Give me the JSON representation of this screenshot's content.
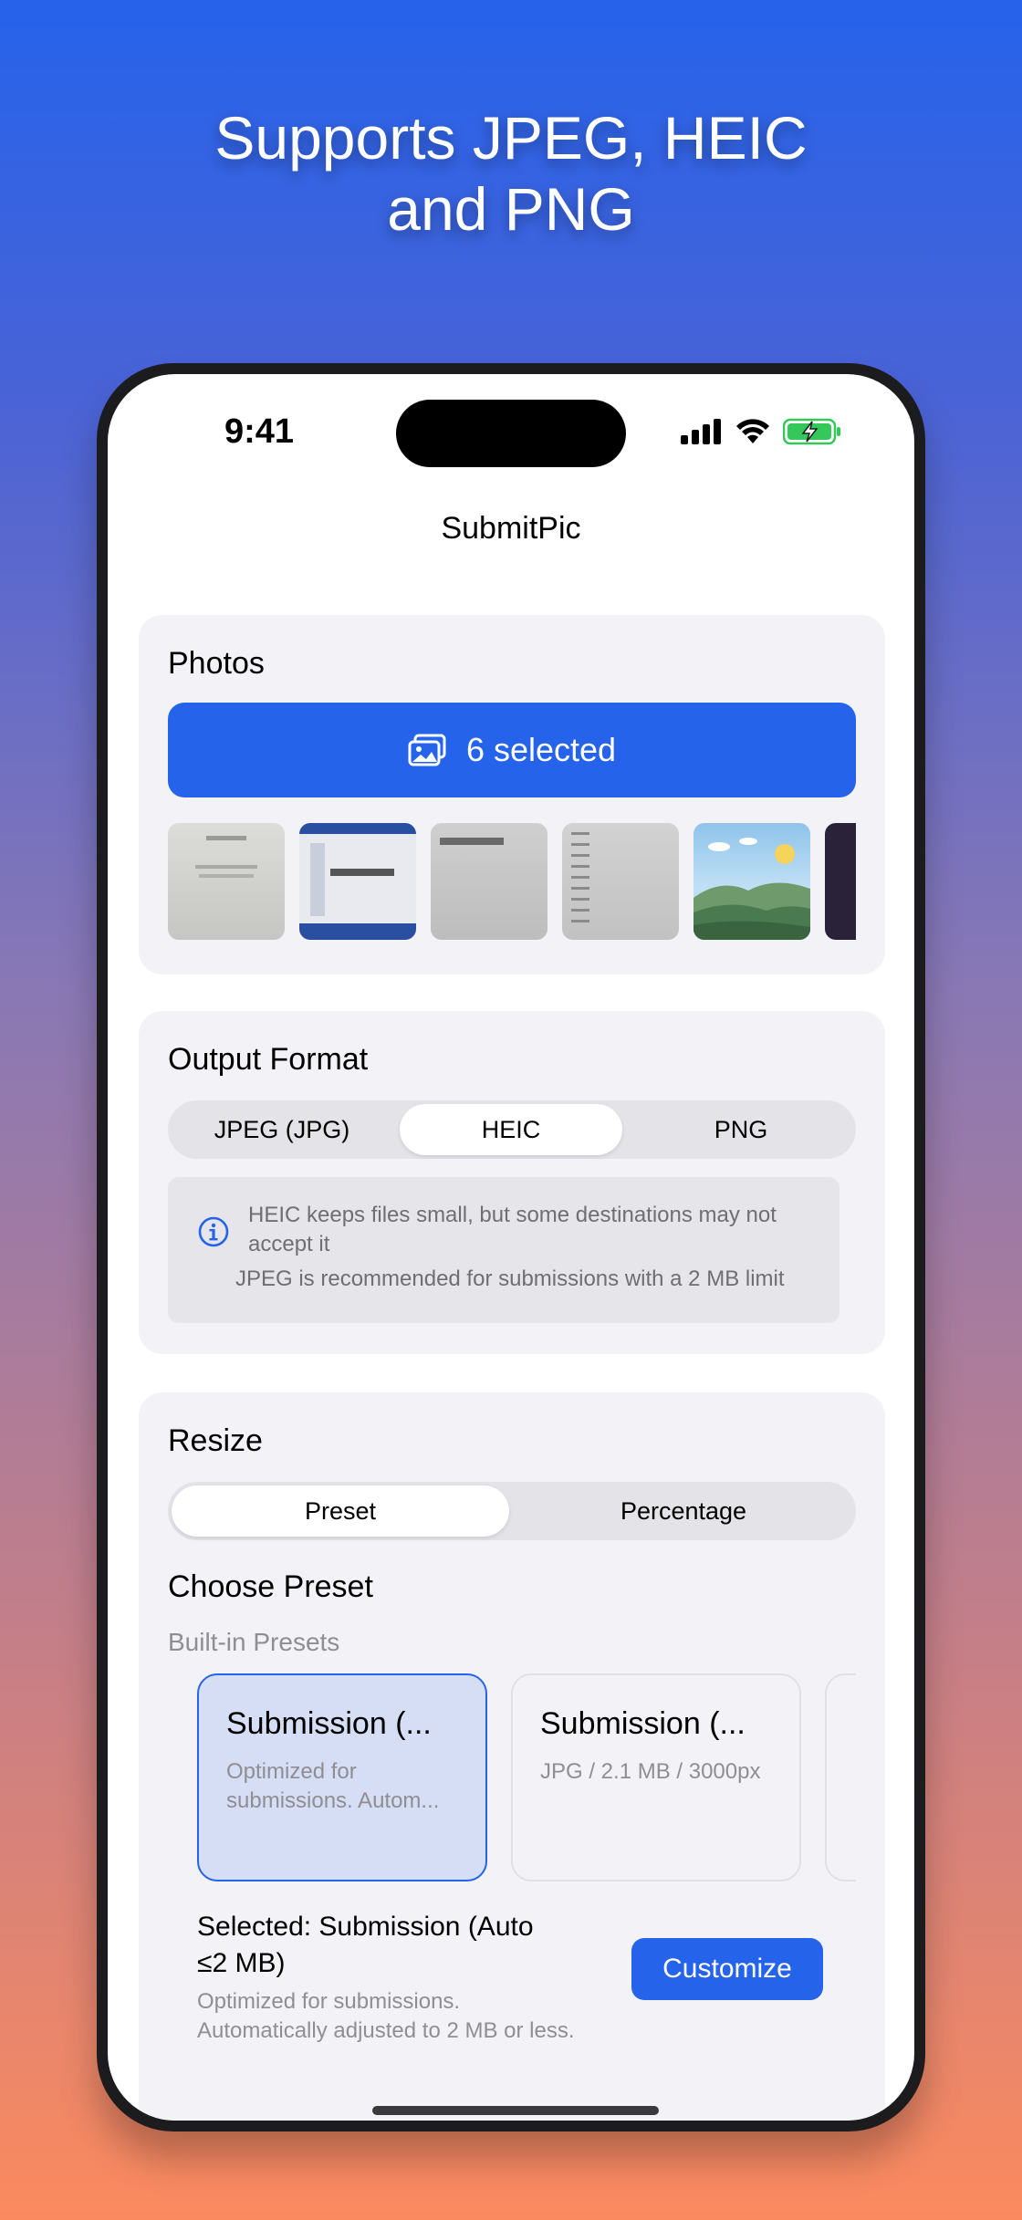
{
  "headline": {
    "line1": "Supports JPEG, HEIC",
    "line2": "and PNG"
  },
  "status_bar": {
    "time": "9:41",
    "icons": [
      "cellular-signal-icon",
      "wifi-icon",
      "battery-charging-icon"
    ]
  },
  "app": {
    "title": "SubmitPic"
  },
  "photos": {
    "section_title": "Photos",
    "select_button_label": "6 selected",
    "thumbnails": [
      "document-scan-thumbnail",
      "screenshot-thumbnail",
      "document-scan-thumbnail",
      "document-list-thumbnail",
      "landscape-photo-thumbnail",
      "dark-photo-thumbnail"
    ]
  },
  "output_format": {
    "section_title": "Output Format",
    "options": [
      "JPEG (JPG)",
      "HEIC",
      "PNG"
    ],
    "selected": "HEIC",
    "info_line1": "HEIC keeps files small, but some destinations may not",
    "info_line2": "accept it",
    "info_line3": "JPEG is recommended for submissions with a 2 MB limit"
  },
  "resize": {
    "section_title": "Resize",
    "modes": [
      "Preset",
      "Percentage"
    ],
    "selected_mode": "Preset",
    "choose_preset_title": "Choose Preset",
    "builtin_label": "Built-in Presets",
    "presets": [
      {
        "title": "Submission (...",
        "desc": "Optimized for submissions. Autom..."
      },
      {
        "title": "Submission (...",
        "desc": "JPG / 2.1 MB / 3000px"
      }
    ],
    "selected_line1": "Selected: Submission (Auto",
    "selected_line2": "≤2 MB)",
    "selected_desc_line1": "Optimized for submissions.",
    "selected_desc_line2": "Automatically adjusted to 2 MB or less.",
    "customize_label": "Customize"
  },
  "colors": {
    "accent": "#2563eb",
    "card_bg": "#f2f2f7",
    "selected_preset_bg": "#d6def5"
  }
}
